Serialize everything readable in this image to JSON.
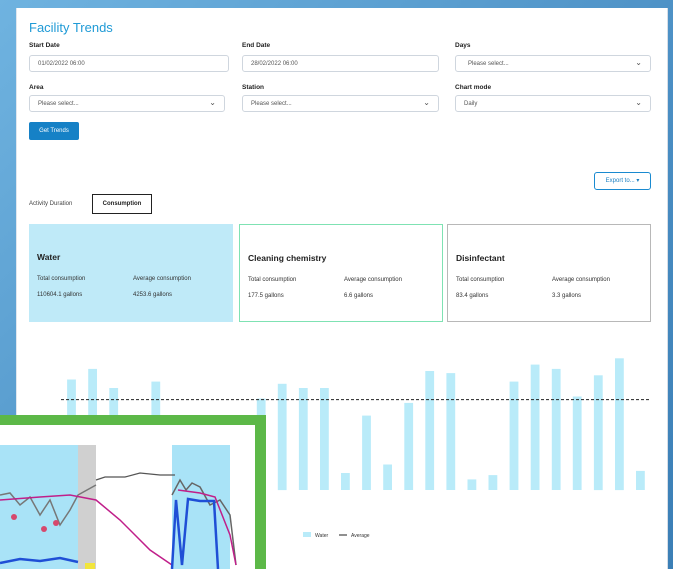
{
  "page": {
    "title": "Facility Trends"
  },
  "filters": {
    "start_date_label": "Start Date",
    "start_date_value": "01/02/2022 06:00",
    "end_date_label": "End Date",
    "end_date_value": "28/02/2022 06:00",
    "days_label": "Days",
    "days_placeholder": "Please select...",
    "area_label": "Area",
    "area_placeholder": "Please select...",
    "station_label": "Station",
    "station_placeholder": "Please select...",
    "chart_mode_label": "Chart mode",
    "chart_mode_value": "Daily"
  },
  "actions": {
    "get_trends": "Get Trends",
    "export": "Export to... ▾"
  },
  "tabs": {
    "activity": "Activity Duration",
    "consumption": "Consumption"
  },
  "summaries": {
    "water": {
      "title": "Water",
      "total_label": "Total consumption",
      "avg_label": "Average consumption",
      "total": "110604.1 gallons",
      "avg": "4253.6 gallons"
    },
    "cleaning": {
      "title": "Cleaning chemistry",
      "total_label": "Total consumption",
      "avg_label": "Average consumption",
      "total": "177.5 gallons",
      "avg": "6.6 gallons"
    },
    "disinfectant": {
      "title": "Disinfectant",
      "total_label": "Total consumption",
      "avg_label": "Average consumption",
      "total": "83.4 gallons",
      "avg": "3.3 gallons"
    }
  },
  "colors": {
    "water_bar": "#b9ebf9",
    "average_line": "#222222",
    "accent": "#1f9ad6",
    "inset_border": "#5cb848"
  },
  "chart_data": {
    "type": "bar",
    "title": "",
    "ylim": [
      0,
      8000
    ],
    "yticks": [
      8000,
      6000,
      4000
    ],
    "ytick_labels": [
      "",
      "",
      ""
    ],
    "categories": [
      "",
      "",
      "",
      "",
      "",
      "",
      "",
      "",
      "",
      "",
      "",
      "",
      "",
      "",
      "",
      "",
      "",
      "",
      "",
      "",
      "",
      "",
      "",
      "",
      "",
      "",
      "",
      "",
      ""
    ],
    "x_tick_labels_visible": [
      "",
      "",
      "",
      "",
      "",
      "",
      "",
      "",
      "",
      "",
      "",
      "",
      "",
      "",
      "",
      "",
      "",
      ""
    ],
    "series": [
      {
        "name": "Water",
        "values": [
          5200,
          5700,
          4800,
          1000,
          5100,
          0,
          2800,
          2400,
          1700,
          4300,
          5000,
          4800,
          4800,
          800,
          3500,
          1200,
          4100,
          5600,
          5500,
          500,
          700,
          5100,
          5900,
          5700,
          4400,
          5400,
          6200,
          900
        ]
      },
      {
        "name": "Average",
        "average": 4253.6
      }
    ],
    "legend": [
      "Water",
      "Average"
    ],
    "legend_position": "bottom"
  },
  "inset": {
    "description_icon": "trend-line-inset"
  }
}
